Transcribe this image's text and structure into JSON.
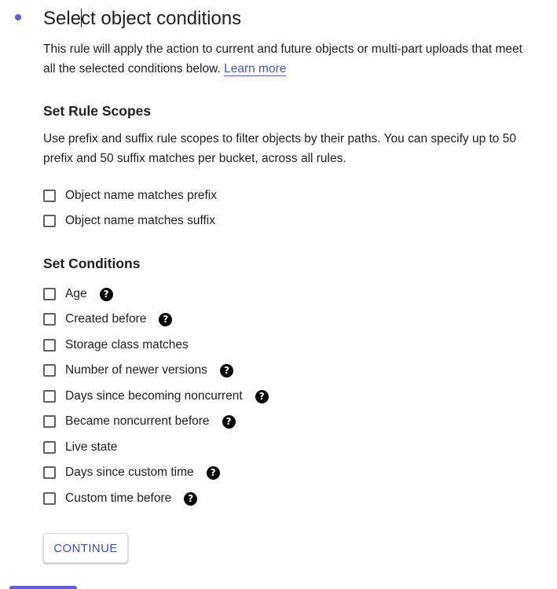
{
  "header": {
    "title_part1": "Sele",
    "title_part2": "ct object conditions",
    "description": "This rule will apply the action to current and future objects or multi-part uploads that meet all the selected conditions below.",
    "learn_more": "Learn more"
  },
  "scopes": {
    "title": "Set Rule Scopes",
    "description": "Use prefix and suffix rule scopes to filter objects by their paths. You can specify up to 50 prefix and 50 suffix matches per bucket, across all rules.",
    "items": [
      {
        "label": "Object name matches prefix",
        "checked": false
      },
      {
        "label": "Object name matches suffix",
        "checked": false
      }
    ]
  },
  "conditions": {
    "title": "Set Conditions",
    "items": [
      {
        "label": "Age",
        "checked": false,
        "help": true
      },
      {
        "label": "Created before",
        "checked": false,
        "help": true
      },
      {
        "label": "Storage class matches",
        "checked": false,
        "help": false
      },
      {
        "label": "Number of newer versions",
        "checked": false,
        "help": true
      },
      {
        "label": "Days since becoming noncurrent",
        "checked": false,
        "help": true
      },
      {
        "label": "Became noncurrent before",
        "checked": false,
        "help": true
      },
      {
        "label": "Live state",
        "checked": false,
        "help": false
      },
      {
        "label": "Days since custom time",
        "checked": false,
        "help": true
      },
      {
        "label": "Custom time before",
        "checked": false,
        "help": true
      }
    ]
  },
  "actions": {
    "continue_label": "CONTINUE"
  },
  "colors": {
    "accent": "#3f51b5",
    "step_dot": "#5c5fcf",
    "text": "#202124"
  },
  "icons": {
    "help": "help-circle-icon",
    "help_glyph": "?"
  }
}
